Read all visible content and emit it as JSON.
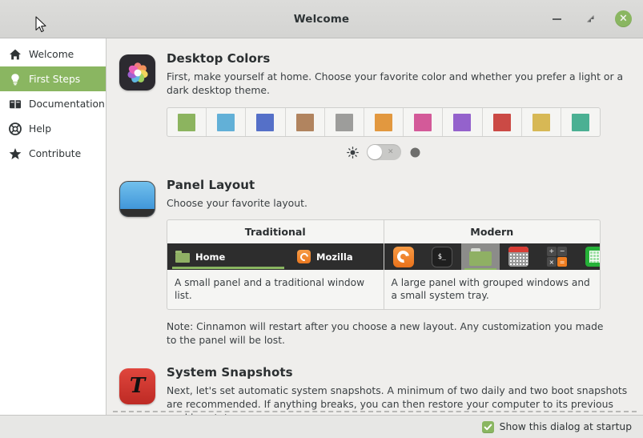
{
  "window": {
    "title": "Welcome",
    "minimize_label": "Minimize",
    "maximize_label": "Restore",
    "close_label": "×"
  },
  "sidebar": {
    "items": [
      {
        "label": "Welcome",
        "icon": "home-icon",
        "active": false
      },
      {
        "label": "First Steps",
        "icon": "lightbulb-icon",
        "active": true
      },
      {
        "label": "Documentation",
        "icon": "book-icon",
        "active": false
      },
      {
        "label": "Help",
        "icon": "lifebuoy-icon",
        "active": false
      },
      {
        "label": "Contribute",
        "icon": "star-icon",
        "active": false
      }
    ]
  },
  "sections": {
    "desktop_colors": {
      "title": "Desktop Colors",
      "description": "First, make yourself at home. Choose your favorite color and whether you prefer a light or a dark desktop theme.",
      "icon": "color-wheel-icon",
      "swatches": [
        {
          "name": "green",
          "color": "#8cb45f"
        },
        {
          "name": "blue",
          "color": "#62b0d7"
        },
        {
          "name": "indigo",
          "color": "#5570c8"
        },
        {
          "name": "brown",
          "color": "#b1845f"
        },
        {
          "name": "grey",
          "color": "#9d9d9b"
        },
        {
          "name": "orange",
          "color": "#e2983f"
        },
        {
          "name": "pink",
          "color": "#d35a99"
        },
        {
          "name": "purple",
          "color": "#9462cc"
        },
        {
          "name": "red",
          "color": "#cb4a45"
        },
        {
          "name": "yellow",
          "color": "#d7b855"
        },
        {
          "name": "teal",
          "color": "#4bb093"
        }
      ],
      "theme_toggle": {
        "light_icon": "sun-icon",
        "dark_icon": "moon-icon",
        "state": "off",
        "off_mark": "×"
      }
    },
    "panel_layout": {
      "title": "Panel Layout",
      "description": "Choose your favorite layout.",
      "icon": "panel-icon",
      "options": [
        {
          "name": "Traditional",
          "description": "A small panel and a traditional window list.",
          "preview_items": [
            {
              "label": "Home",
              "icon": "folder-icon",
              "selected": true
            },
            {
              "label": "Mozilla",
              "icon": "firefox-icon",
              "selected": false
            }
          ]
        },
        {
          "name": "Modern",
          "description": "A large panel with grouped windows and a small system tray.",
          "preview_items": [
            {
              "icon": "firefox-icon",
              "selected": false
            },
            {
              "icon": "terminal-icon",
              "label": "$_",
              "selected": false
            },
            {
              "icon": "folder-icon",
              "selected": true
            },
            {
              "icon": "calendar-icon",
              "selected": false
            },
            {
              "icon": "calculator-icon",
              "keys": [
                "+",
                "−",
                "×",
                "="
              ],
              "selected": false
            },
            {
              "icon": "spreadsheet-icon",
              "selected": false
            }
          ]
        }
      ],
      "note": "Note: Cinnamon will restart after you choose a new layout. Any customization you made to the panel will be lost."
    },
    "system_snapshots": {
      "title": "System Snapshots",
      "description": "Next, let's set automatic system snapshots. A minimum of two daily and two boot snapshots are recommended. If anything breaks, you can then restore your computer to its previous working state.",
      "icon": "timeshift-icon",
      "icon_glyph": "T"
    }
  },
  "statusbar": {
    "startup_checkbox": {
      "label": "Show this dialog at startup",
      "checked": true
    }
  },
  "colors": {
    "accent": "#8ab661",
    "titlebar": "#d8d8d6",
    "content_bg": "#efeeec",
    "sidebar_bg": "#ffffff"
  }
}
